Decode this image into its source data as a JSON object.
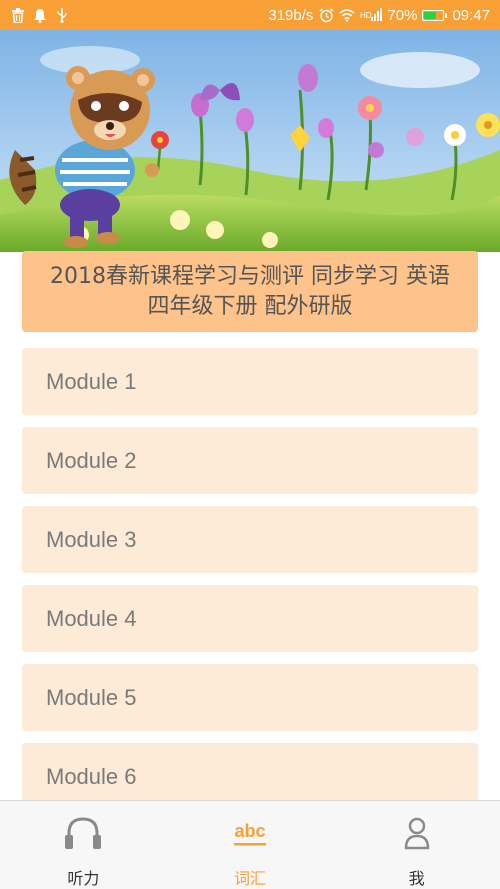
{
  "status_bar": {
    "network_speed": "319b/s",
    "battery_percent": "70%",
    "battery_level": 0.7,
    "time": "09:47",
    "left_icons": [
      "trash-icon",
      "notification-bell-icon",
      "usb-icon"
    ],
    "right_icons": [
      "alarm-icon",
      "wifi-icon",
      "hd-signal-icon"
    ]
  },
  "banner": {
    "image": "cartoon-raccoon-meadow-illustration"
  },
  "book_title": "2018春新课程学习与测评 同步学习 英语 四年级下册 配外研版",
  "modules": [
    {
      "label": "Module 1"
    },
    {
      "label": "Module 2"
    },
    {
      "label": "Module 3"
    },
    {
      "label": "Module 4"
    },
    {
      "label": "Module 5"
    },
    {
      "label": "Module 6"
    }
  ],
  "tabs": [
    {
      "label": "听力",
      "icon": "headphones-icon"
    },
    {
      "label": "词汇",
      "icon": "abc-icon",
      "active": true
    },
    {
      "label": "我",
      "icon": "person-icon"
    }
  ],
  "colors": {
    "accent": "#f8a035",
    "title_bg": "#fdc38a",
    "module_bg": "#fdebd8"
  }
}
